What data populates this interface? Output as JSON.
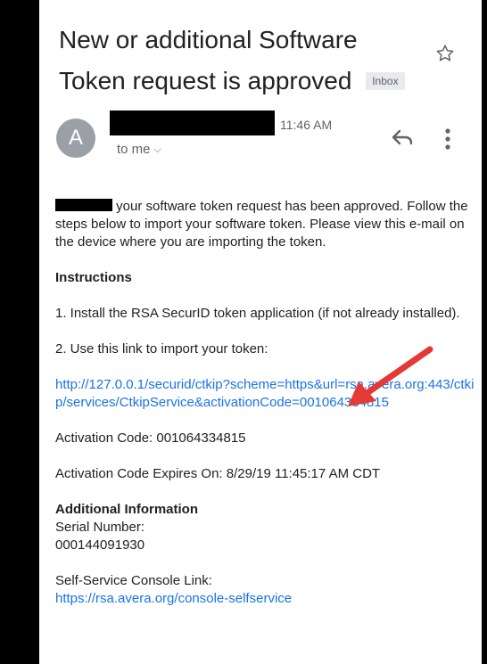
{
  "email": {
    "subject": "New or additional Software Token  request is approved",
    "label_inbox": "Inbox",
    "avatar_letter": "A",
    "time": "11:46 AM",
    "to_me": "to me",
    "body": {
      "intro": "your software token request has been approved. Follow the steps below to import your software token. Please view this e-mail on the device where you are importing the token.",
      "instructions_heading": "Instructions",
      "step1": "1. Install the RSA SecurID token application (if not already installed).",
      "step2": "2. Use this link to import your token:",
      "import_link": "http://127.0.0.1/securid/ctkip?scheme=https&url=rsa.avera.org:443/ctkip/services/CtkipService&activationCode=001064334815",
      "activation_code": "Activation Code: 001064334815",
      "activation_expires": "Activation Code Expires On: 8/29/19 11:45:17 AM CDT",
      "additional_heading": "Additional Information",
      "serial_label": "Serial Number:",
      "serial_value": "000144091930",
      "console_label": "Self-Service Console Link:",
      "console_link": "https://rsa.avera.org/console-selfservice"
    }
  },
  "colors": {
    "link": "#1a73e8",
    "avatar": "#9aa0a6",
    "annotation_arrow": "#e53935"
  },
  "icons": [
    "star-icon",
    "reply-icon",
    "more-vert-icon",
    "chevron-down-icon"
  ]
}
